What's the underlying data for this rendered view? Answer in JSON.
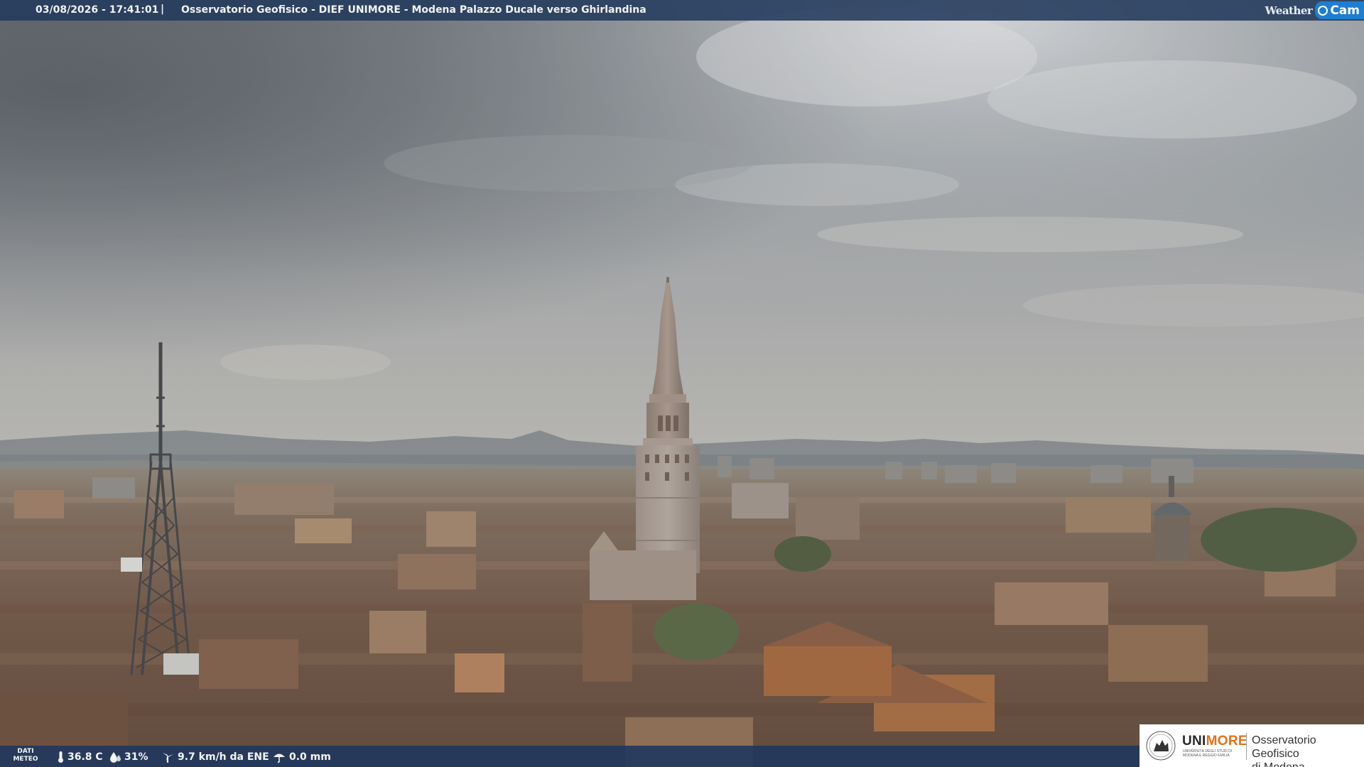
{
  "overlay": {
    "timestamp": "03/08/2026 - 17:41:01",
    "separator": "|",
    "caption": "Osservatorio Geofisico - DIEF UNIMORE - Modena Palazzo Ducale verso Ghirlandina",
    "brand_weather": "Weather",
    "brand_cam": "Cam"
  },
  "weather": {
    "label_line1": "DATI",
    "label_line2": "METEO",
    "temperature": "36.8 C",
    "humidity": "31%",
    "wind": "9.7 km/h da ENE",
    "rain": "0.0 mm"
  },
  "logo": {
    "uni_part1": "UNI",
    "uni_part2": "MORE",
    "uni_sub": "UNIVERSITÀ DEGLI STUDI DI MODENA E REGGIO EMILIA",
    "observatory_line1": "Osservatorio Geofisico",
    "observatory_line2": "di Modena"
  },
  "colors": {
    "bar": "#233a5c",
    "accent": "#1e7fd0",
    "unimore_orange": "#e2721b"
  },
  "icons": {
    "temperature": "thermometer-icon",
    "humidity": "droplets-icon",
    "wind": "wind-turbine-icon",
    "rain": "rain-umbrella-icon"
  }
}
